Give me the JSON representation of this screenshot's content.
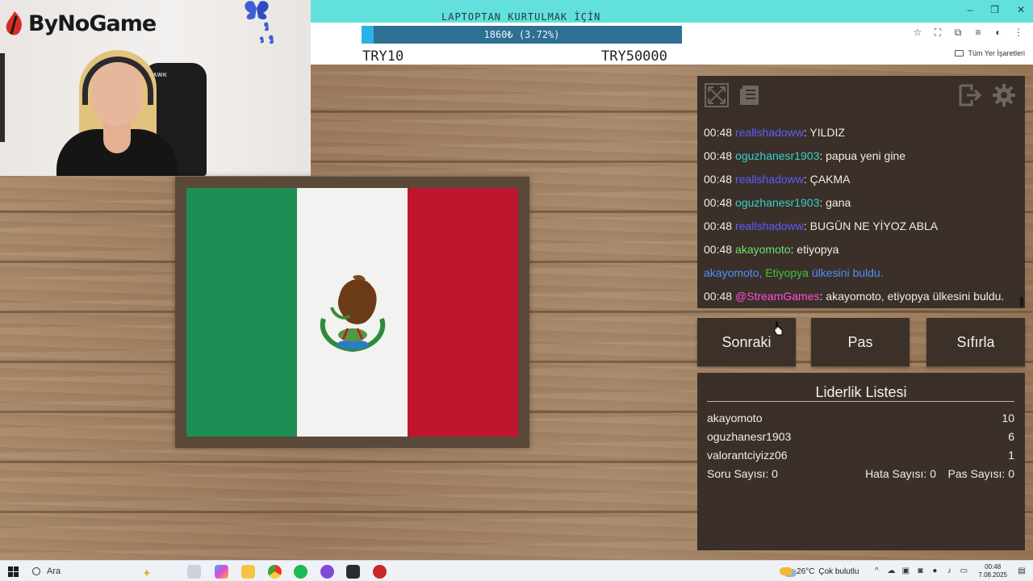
{
  "webcam": {
    "logo_text": "ByNoGame",
    "chair_label": "HAWK"
  },
  "browser": {
    "goal_title": "LAPTOPTAN KURTULMAK İÇİN",
    "progress_label": "1860₺ (3.72%)",
    "progress_fraction": 0.0372,
    "goal_min": "TRY10",
    "goal_max": "TRY50000",
    "bookmarks_label": "Tüm Yer İşaretleri"
  },
  "flag": {
    "colors": [
      "#1e8e55",
      "#f2f2f0",
      "#c0142f"
    ]
  },
  "chat": {
    "messages": [
      {
        "time": "00:48",
        "user": "reallshadoww",
        "user_color": "#5b5cff",
        "text": ": YILDIZ"
      },
      {
        "time": "00:48",
        "user": "oguzhanesr1903",
        "user_color": "#2fd3c8",
        "text": ": papua yeni gine"
      },
      {
        "time": "00:48",
        "user": "reallshadoww",
        "user_color": "#5b5cff",
        "text": ": ÇAKMA"
      },
      {
        "time": "00:48",
        "user": "oguzhanesr1903",
        "user_color": "#2fd3c8",
        "text": ": gana"
      },
      {
        "time": "00:48",
        "user": "reallshadoww",
        "user_color": "#5b5cff",
        "text": ": BUGÜN NE YİYOZ ABLA"
      },
      {
        "time": "00:48",
        "user": "akayomoto",
        "user_color": "#6ee06e",
        "text": ": etiyopya"
      }
    ],
    "system": {
      "user": "akayomoto,",
      "country": "Etiyopya",
      "suffix": "ülkesini buldu."
    },
    "bot_message": {
      "time": "00:48",
      "user": "@StreamGames",
      "user_color": "#ff4fd8",
      "text": ": akayomoto, etiyopya ülkesini buldu."
    }
  },
  "buttons": {
    "next": "Sonraki",
    "pass": "Pas",
    "reset": "Sıfırla"
  },
  "leaderboard": {
    "title": "Liderlik Listesi",
    "rows": [
      {
        "name": "akayomoto",
        "score": "10"
      },
      {
        "name": "oguzhanesr1903",
        "score": "6"
      },
      {
        "name": "valorantciyizz06",
        "score": "1"
      }
    ],
    "question_count": "Soru Sayısı: 0",
    "error_count": "Hata Sayısı: 0",
    "pass_count": "Pas Sayısı: 0"
  },
  "taskbar": {
    "search_label": "Ara",
    "temperature": "26°C",
    "weather": "Çok bulutlu",
    "time": "00:48",
    "date": "7.08.2025"
  }
}
